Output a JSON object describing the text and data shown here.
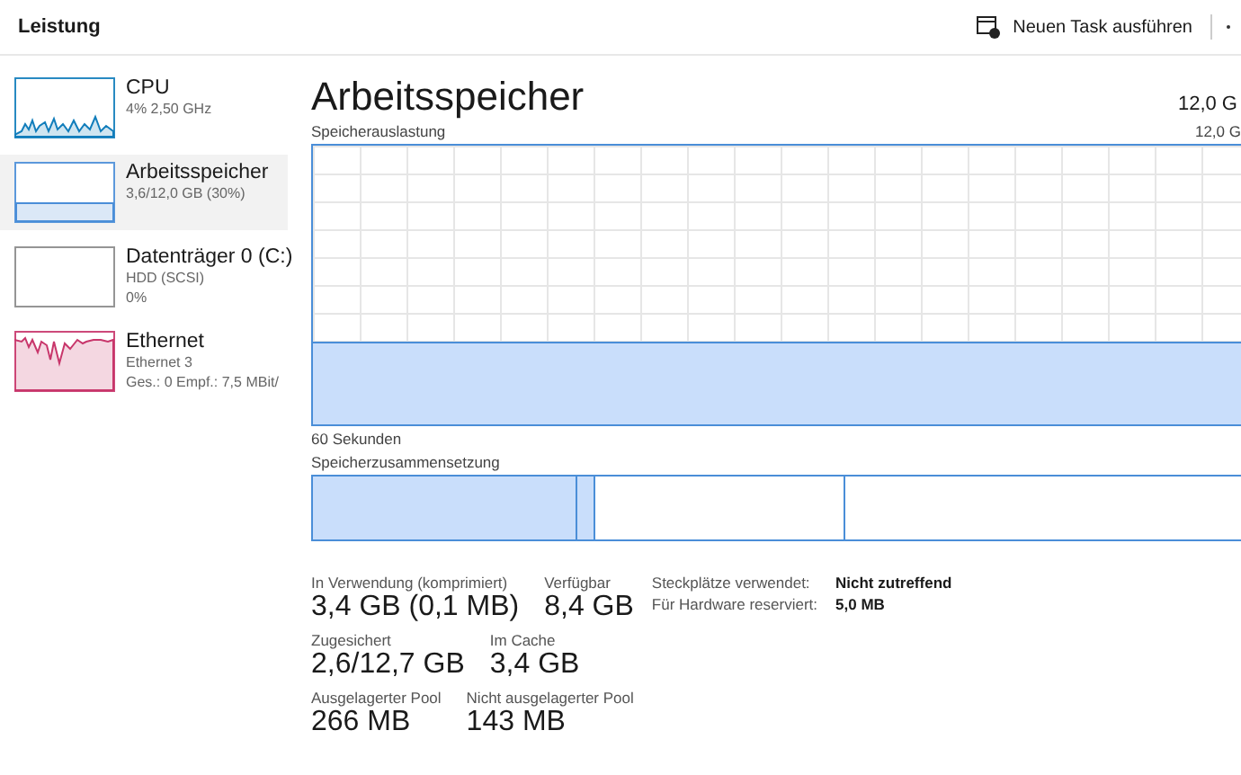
{
  "header": {
    "title": "Leistung",
    "run_task": "Neuen Task ausführen"
  },
  "sidebar": {
    "items": [
      {
        "kind": "spark",
        "name": "CPU",
        "detail": [
          "4%  2,50 GHz"
        ],
        "color": "#117dbb",
        "selected": false
      },
      {
        "kind": "fill",
        "name": "Arbeitsspeicher",
        "detail": [
          "3,6/12,0 GB (30%)"
        ],
        "color": "#4a8ed8",
        "selected": true
      },
      {
        "kind": "empty",
        "name": "Datenträger 0 (C:)",
        "detail": [
          "HDD (SCSI)",
          "0%"
        ],
        "color": "#8a8a8a",
        "selected": false
      },
      {
        "kind": "net",
        "name": "Ethernet",
        "detail": [
          "Ethernet 3",
          "Ges.: 0 Empf.: 7,5 MBit/"
        ],
        "color": "#c8366b",
        "selected": false
      }
    ]
  },
  "main": {
    "title": "Arbeitsspeicher",
    "total": "12,0 G",
    "usage_label": "Speicherauslastung",
    "usage_max": "12,0 G",
    "time_label": "60 Sekunden",
    "composition_label": "Speicherzusammensetzung",
    "composition": [
      {
        "kind": "used"
      },
      {
        "kind": "modified"
      },
      {
        "kind": "standby"
      },
      {
        "kind": "free"
      }
    ],
    "stat_rows": [
      [
        {
          "label": "In Verwendung (komprimiert)",
          "value": "3,4 GB (0,1 MB)"
        },
        {
          "label": "Verfügbar",
          "value": "8,4 GB"
        }
      ],
      [
        {
          "label": "Zugesichert",
          "value": "2,6/12,7 GB"
        },
        {
          "label": "Im Cache",
          "value": "3,4 GB"
        }
      ],
      [
        {
          "label": "Ausgelagerter Pool",
          "value": "266 MB"
        },
        {
          "label": "Nicht ausgelagerter Pool",
          "value": "143 MB"
        }
      ]
    ],
    "properties": [
      {
        "key": "Steckplätze verwendet:",
        "value": "Nicht zutreffend"
      },
      {
        "key": "Für Hardware reserviert:",
        "value": "5,0 MB"
      }
    ]
  }
}
